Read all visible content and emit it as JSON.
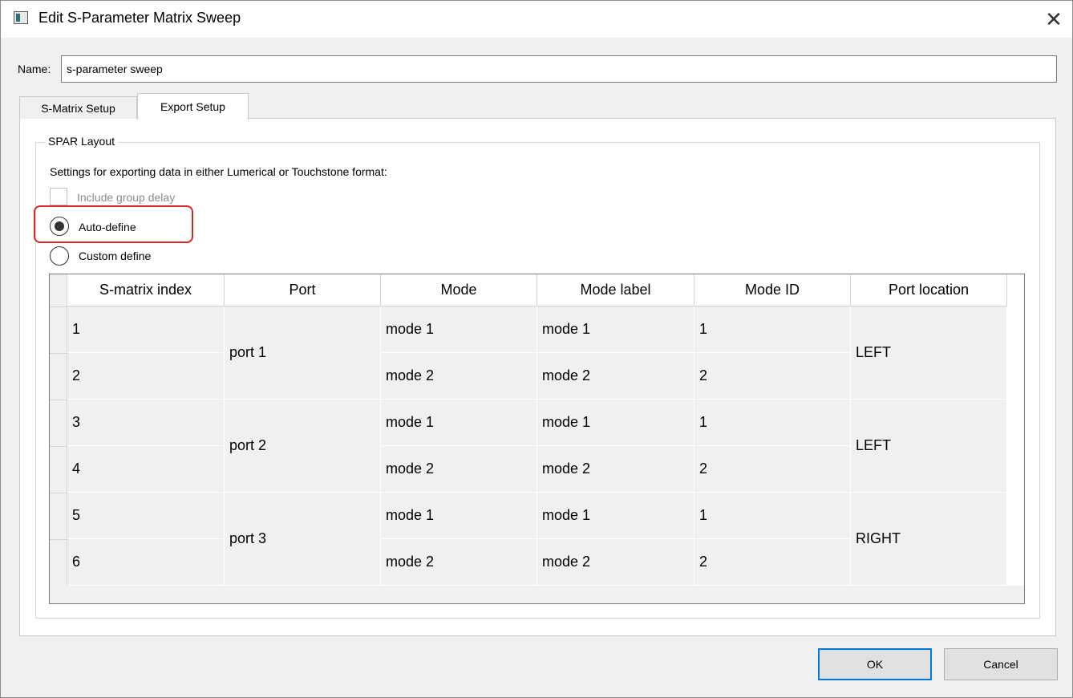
{
  "window": {
    "title": "Edit S-Parameter Matrix Sweep",
    "close_symbol": "✕"
  },
  "name_field": {
    "label": "Name:",
    "value": "s-parameter sweep"
  },
  "tabs": [
    {
      "label": "S-Matrix Setup",
      "active": false
    },
    {
      "label": "Export Setup",
      "active": true
    }
  ],
  "spar_layout": {
    "group_title": "SPAR Layout",
    "description": "Settings for exporting data in either Lumerical or Touchstone format:",
    "include_group_delay": {
      "label": "Include group delay",
      "checked": false,
      "enabled": false
    },
    "radio_options": [
      {
        "label": "Auto-define",
        "checked": true
      },
      {
        "label": "Custom define",
        "checked": false
      }
    ],
    "highlight_color": "#d62828"
  },
  "table": {
    "headers": [
      "S-matrix index",
      "Port",
      "Mode",
      "Mode label",
      "Mode ID",
      "Port location"
    ],
    "rows": [
      {
        "index": "1",
        "mode": "mode 1",
        "mode_label": "mode 1",
        "mode_id": "1"
      },
      {
        "index": "2",
        "mode": "mode 2",
        "mode_label": "mode 2",
        "mode_id": "2"
      },
      {
        "index": "3",
        "mode": "mode 1",
        "mode_label": "mode 1",
        "mode_id": "1"
      },
      {
        "index": "4",
        "mode": "mode 2",
        "mode_label": "mode 2",
        "mode_id": "2"
      },
      {
        "index": "5",
        "mode": "mode 1",
        "mode_label": "mode 1",
        "mode_id": "1"
      },
      {
        "index": "6",
        "mode": "mode 2",
        "mode_label": "mode 2",
        "mode_id": "2"
      }
    ],
    "port_groups": [
      {
        "port": "port 1",
        "location": "LEFT"
      },
      {
        "port": "port 2",
        "location": "LEFT"
      },
      {
        "port": "port 3",
        "location": "RIGHT"
      }
    ]
  },
  "buttons": {
    "ok": "OK",
    "cancel": "Cancel"
  },
  "colors": {
    "ok_border": "#0078d7",
    "cell_background": "#f0f0f0"
  }
}
